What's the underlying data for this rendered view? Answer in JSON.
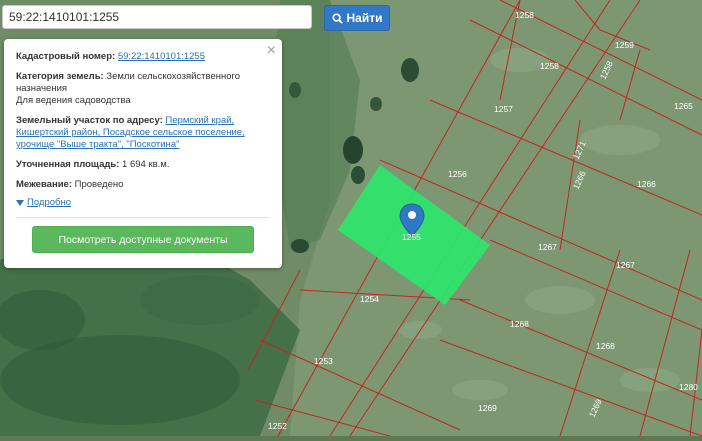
{
  "search": {
    "value": "59:22:1410101:1255",
    "button_label": "Найти"
  },
  "popup": {
    "cadastral_label": "Кадастровый номер:",
    "cadastral_number": "59:22:1410101:1255",
    "category_label": "Категория земель:",
    "category_value": "Земли сельскохозяйственного назначения",
    "usage_value": "Для ведения садоводства",
    "address_label": "Земельный участок по адресу:",
    "address_value": "Пермский край, Кишертский район, Посадское сельское поселение, урочище \"Выше тракта\", \"Поскотина\"",
    "area_label": "Уточненная площадь:",
    "area_value": "1 694 кв.м.",
    "survey_label": "Межевание:",
    "survey_value": "Проведено",
    "details_label": "Подробно",
    "docs_button_label": "Посмотреть доступные документы",
    "close_label": "×"
  },
  "map": {
    "selected_parcel_color": "#2ee66b",
    "boundary_color": "#c02626",
    "marker_color": "#2f79c2",
    "marker_label": "1255",
    "plot_labels": [
      "1258",
      "1259",
      "1258",
      "1258",
      "1257",
      "1265",
      "1271",
      "1256",
      "1266",
      "1266",
      "1267",
      "1267",
      "1254",
      "1268",
      "1268",
      "1253",
      "1269",
      "1280",
      "1269",
      "1252"
    ]
  }
}
